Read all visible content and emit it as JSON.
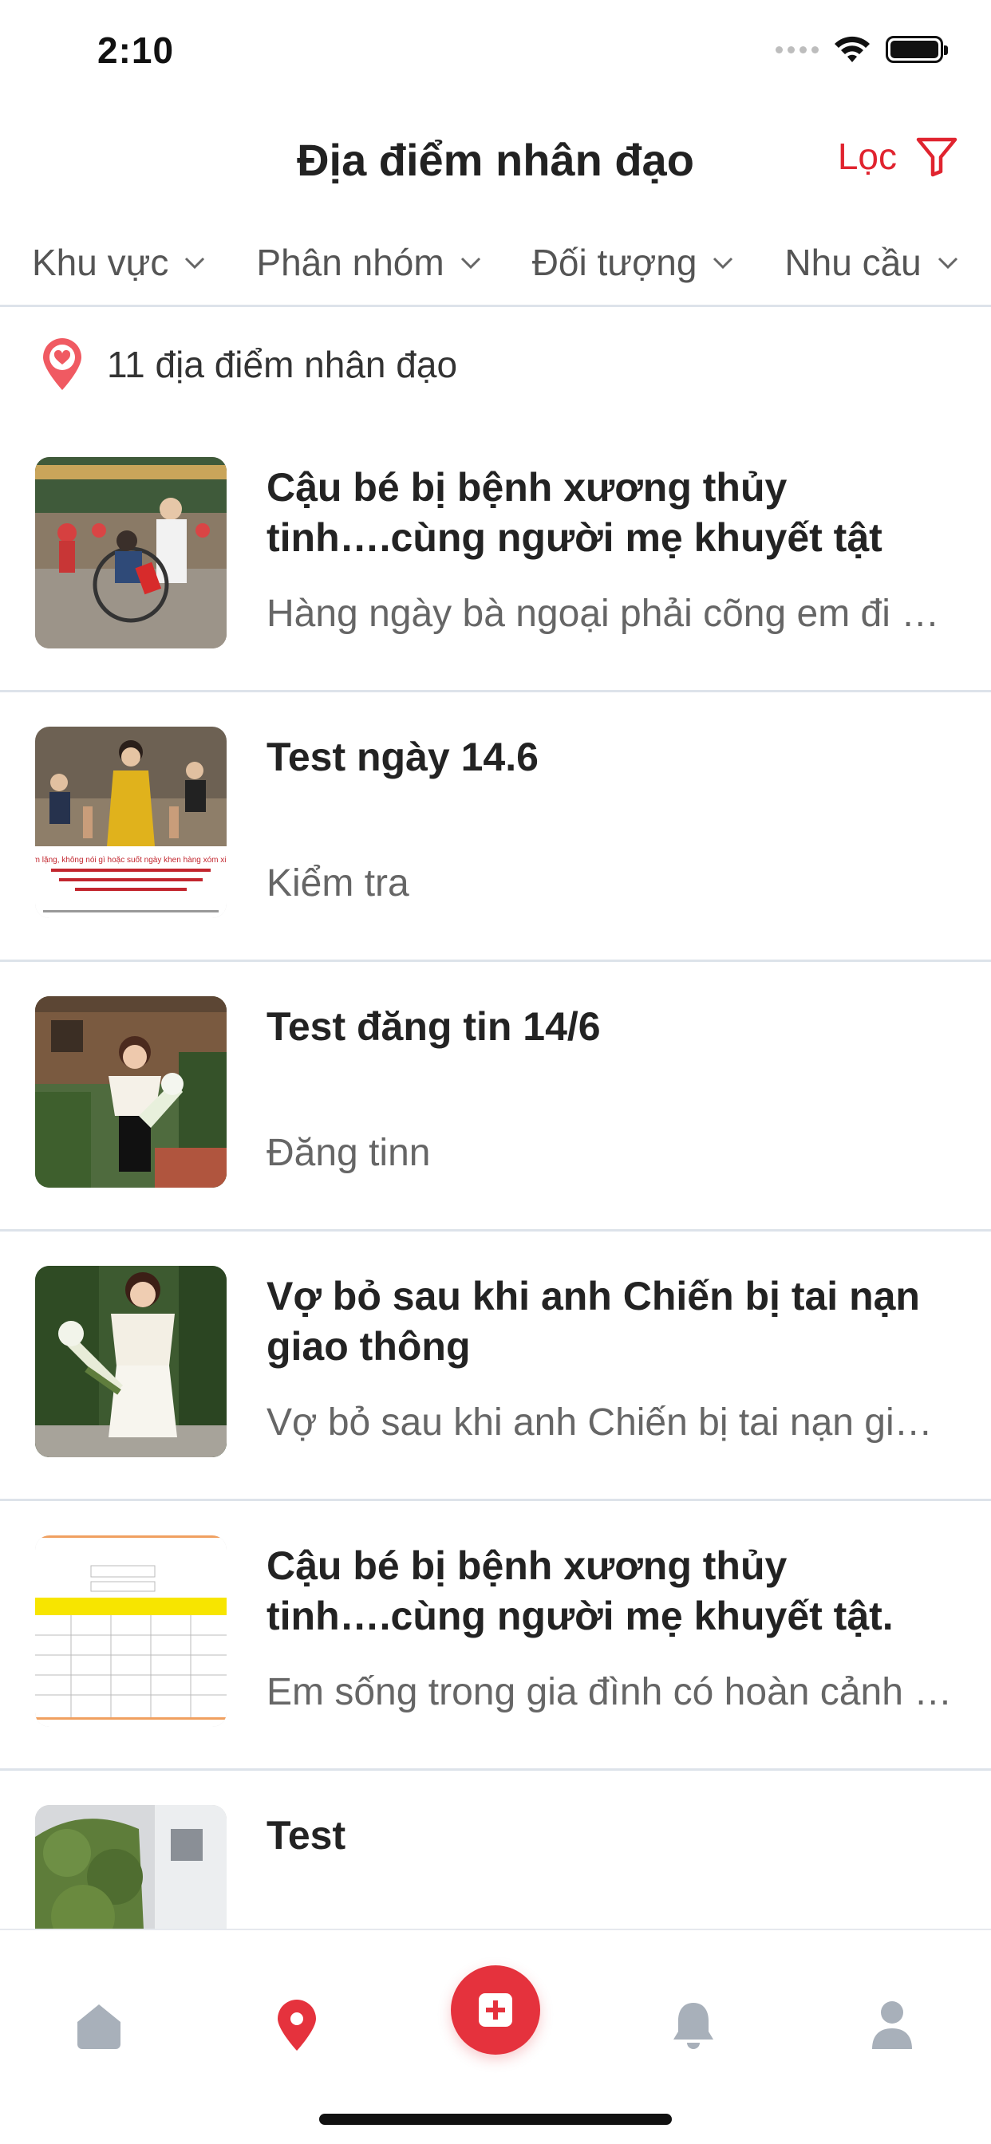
{
  "status_bar": {
    "time": "2:10"
  },
  "header": {
    "title": "Địa điểm nhân đạo",
    "filter_label": "Lọc"
  },
  "filter_tabs": [
    {
      "label": "Khu vực"
    },
    {
      "label": "Phân nhóm"
    },
    {
      "label": "Đối tượng"
    },
    {
      "label": "Nhu cầu"
    }
  ],
  "count_text": "11 địa điểm nhân đạo",
  "items": [
    {
      "title": "Cậu bé bị bệnh xương thủy tinh….cùng người mẹ khuyết tật",
      "description": "Hàng ngày bà ngoại phải cõng em đi học"
    },
    {
      "title": "Test ngày 14.6",
      "description": "Kiểm tra",
      "image_caption": "Đại biểu Quốc hội: \"Chồng đi làm về nhà nhưng im lặng, không nói gì hoặc suốt ngày khen hàng xóm xinh đẹp, chu đáo cũng là hành vi bạo lực gia đình\""
    },
    {
      "title": "Test đăng tin 14/6",
      "description": "Đăng tinn"
    },
    {
      "title": "Vợ bỏ sau khi anh Chiến bị tai nạn giao thông",
      "description": "Vợ bỏ sau khi anh Chiến bị tai nạn giao thông"
    },
    {
      "title": "Cậu bé bị bệnh xương thủy tinh….cùng người mẹ khuyết tật.",
      "description": "Em sống trong gia đình có hoàn cảnh khó khăn"
    },
    {
      "title": "Test",
      "description": ""
    }
  ],
  "nav": {
    "home_icon": "home-icon",
    "map_icon": "map-pin-icon",
    "add_icon": "plus-icon",
    "notify_icon": "bell-icon",
    "profile_icon": "user-icon"
  },
  "colors": {
    "accent": "#e5323d",
    "inactive_icon": "#a8b0ba",
    "divider": "#dde3ea"
  }
}
